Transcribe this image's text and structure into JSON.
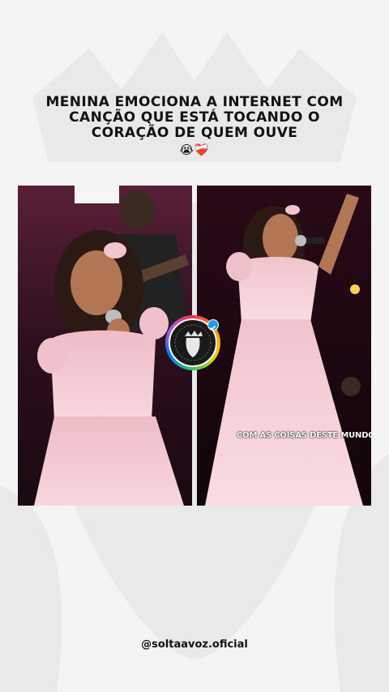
{
  "post": {
    "headline_lines": [
      "MENINA EMOCIONA A INTERNET COM",
      "CANÇÃO QUE ESTÁ TOCANDO  O",
      "CORAÇÃO DE QUEM OUVE"
    ],
    "emojis": "😭❤️‍🩹",
    "caption": "COM AS COISAS DESTE MUNDO",
    "handle": "@soltaavoz.oficial"
  },
  "icons": {
    "profile_badge": "lion-logo-icon",
    "verified": "verified-check-icon",
    "watermark": "lion-watermark-icon"
  },
  "colors": {
    "background": "#f4f4f4",
    "text": "#121212",
    "dress_pink": "#f3c8cf",
    "stage_dark": "#2a0f1e",
    "verified_blue": "#1d9bf0"
  }
}
